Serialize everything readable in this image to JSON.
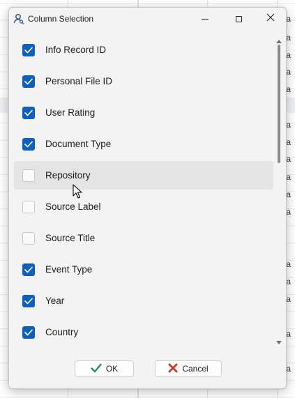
{
  "dialog": {
    "title": "Column Selection",
    "title_icon": "user-search-icon",
    "window_controls": [
      "minimize-icon",
      "maximize-icon",
      "close-icon"
    ]
  },
  "columns": [
    {
      "label": "Info Record ID",
      "checked": true
    },
    {
      "label": "Personal File ID",
      "checked": true
    },
    {
      "label": "User Rating",
      "checked": true
    },
    {
      "label": "Document Type",
      "checked": true
    },
    {
      "label": "Repository",
      "checked": false,
      "hovered": true
    },
    {
      "label": "Source Label",
      "checked": false
    },
    {
      "label": "Source Title",
      "checked": false
    },
    {
      "label": "Event Type",
      "checked": true
    },
    {
      "label": "Year",
      "checked": true
    },
    {
      "label": "Country",
      "checked": true
    }
  ],
  "buttons": {
    "ok_label": "OK",
    "ok_icon": "checkmark-icon",
    "cancel_label": "Cancel",
    "cancel_icon": "x-icon"
  },
  "background": {
    "cell_text": [
      "nia",
      "nia",
      "nia",
      "nia",
      "nia",
      "nia",
      "nia",
      "nia",
      "nia",
      "nia",
      "nia",
      "nia",
      "nia",
      "nia",
      "nia",
      "nia"
    ]
  },
  "colors": {
    "accent": "#1160b8",
    "ok_icon": "#2e8b57",
    "cancel_icon": "#c0392b",
    "dialog_bg": "#f3f3f3",
    "hover_bg": "#e4e4e4"
  }
}
